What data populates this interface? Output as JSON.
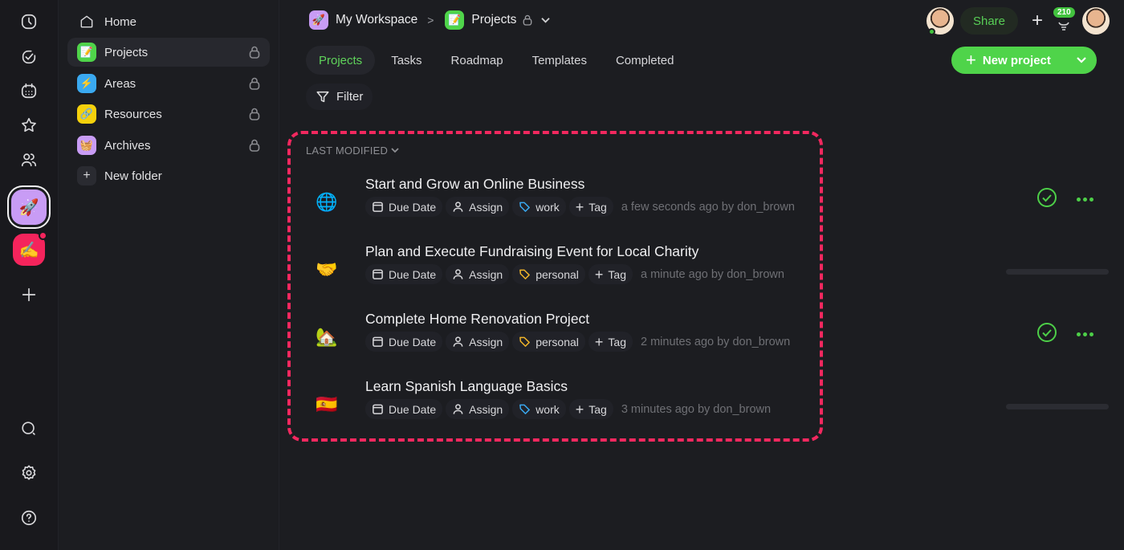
{
  "rail": {
    "icons": [
      "clock-icon",
      "check-circle-icon",
      "calendar-icon",
      "star-icon",
      "people-icon"
    ],
    "workspaces": [
      {
        "name": "my-workspace",
        "emoji": "🚀",
        "color": "#c89cf5",
        "active": true
      },
      {
        "name": "red-workspace",
        "emoji": "✍️",
        "color": "#f5245c",
        "notification": true
      }
    ],
    "bottom_icons": [
      "search-icon",
      "gear-icon",
      "help-icon"
    ]
  },
  "sidebar": {
    "home_label": "Home",
    "items": [
      {
        "label": "Projects",
        "emoji": "📝",
        "color": "#4fd44a",
        "active": true,
        "locked": true
      },
      {
        "label": "Areas",
        "emoji": "⚡",
        "color": "#3aa9f0",
        "active": false,
        "locked": true
      },
      {
        "label": "Resources",
        "emoji": "🔗",
        "color": "#f5d10c",
        "active": false,
        "locked": true
      },
      {
        "label": "Archives",
        "emoji": "🧺",
        "color": "#c89cf5",
        "active": false,
        "locked": true
      }
    ],
    "new_folder_label": "New folder"
  },
  "breadcrumb": {
    "workspace": "My Workspace",
    "workspace_emoji": "🚀",
    "current": "Projects",
    "current_emoji": "📝"
  },
  "tabs": [
    {
      "label": "Projects",
      "active": true
    },
    {
      "label": "Tasks"
    },
    {
      "label": "Roadmap"
    },
    {
      "label": "Templates"
    },
    {
      "label": "Completed"
    }
  ],
  "filter_label": "Filter",
  "header": {
    "share_label": "Share",
    "notification_count": "210",
    "new_project_label": "New project"
  },
  "sort_label": "LAST MODIFIED",
  "chip_labels": {
    "due_date": "Due Date",
    "assign": "Assign",
    "tag": "Tag"
  },
  "colors": {
    "accent": "#4fd44a",
    "highlight": "#f2285f",
    "tag_work": "#3aa9f0",
    "tag_personal": "#f0b429"
  },
  "projects": [
    {
      "title": "Start and Grow an Online Business",
      "emoji": "🌐",
      "tag": "work",
      "meta": "a few seconds ago by don_brown",
      "status": "complete"
    },
    {
      "title": "Plan and Execute Fundraising Event for Local Charity",
      "emoji": "🤝",
      "tag": "personal",
      "meta": "a minute ago by don_brown",
      "status": "progress"
    },
    {
      "title": "Complete Home Renovation Project",
      "emoji": "🏡",
      "tag": "personal",
      "meta": "2 minutes ago by don_brown",
      "status": "complete"
    },
    {
      "title": "Learn Spanish Language Basics",
      "emoji": "🇪🇸",
      "tag": "work",
      "meta": "3 minutes ago by don_brown",
      "status": "progress"
    }
  ]
}
